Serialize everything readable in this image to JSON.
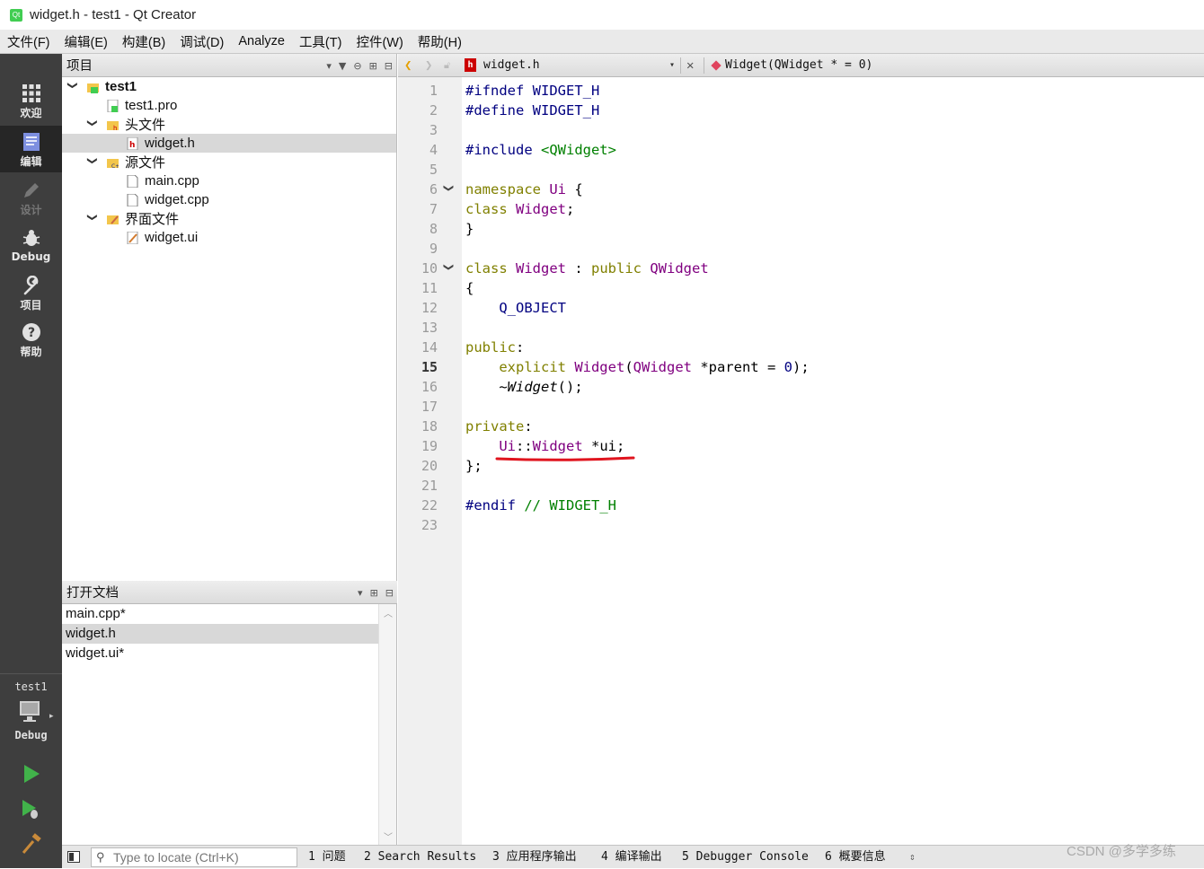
{
  "window": {
    "title": "widget.h - test1 - Qt Creator",
    "app_icon": "Qt"
  },
  "menubar": [
    "文件(F)",
    "编辑(E)",
    "构建(B)",
    "调试(D)",
    "Analyze",
    "工具(T)",
    "控件(W)",
    "帮助(H)"
  ],
  "modes": [
    {
      "label": "欢迎",
      "icon": "grid-icon"
    },
    {
      "label": "编辑",
      "icon": "edit-doc-icon"
    },
    {
      "label": "设计",
      "icon": "pencil-icon"
    },
    {
      "label": "Debug",
      "icon": "bug-icon"
    },
    {
      "label": "项目",
      "icon": "wrench-icon"
    },
    {
      "label": "帮助",
      "icon": "help-icon"
    }
  ],
  "kit": {
    "project": "test1",
    "build": "Debug"
  },
  "project_pane": {
    "title": "项目",
    "tree": [
      {
        "label": "test1"
      },
      {
        "label": "test1.pro"
      },
      {
        "label": "头文件"
      },
      {
        "label": "widget.h"
      },
      {
        "label": "源文件"
      },
      {
        "label": "main.cpp"
      },
      {
        "label": "widget.cpp"
      },
      {
        "label": "界面文件"
      },
      {
        "label": "widget.ui"
      }
    ]
  },
  "open_docs": {
    "title": "打开文档",
    "items": [
      "main.cpp*",
      "widget.h",
      "widget.ui*"
    ]
  },
  "editor": {
    "file": "widget.h",
    "symbol": "Widget(QWidget * = 0)",
    "current_line": 15,
    "line_numbers": [
      "1",
      "2",
      "3",
      "4",
      "5",
      "6",
      "7",
      "8",
      "9",
      "10",
      "11",
      "12",
      "13",
      "14",
      "15",
      "16",
      "17",
      "18",
      "19",
      "20",
      "21",
      "22",
      "23"
    ],
    "lines": {
      "l1a": "#ifndef",
      "l1b": " WIDGET_H",
      "l2a": "#define",
      "l2b": " WIDGET_H",
      "l4a": "#include",
      "l4b": " <QWidget>",
      "l6a": "namespace",
      "l6b": " Ui",
      "l6c": " {",
      "l7a": "class",
      "l7b": " Widget",
      "l7c": ";",
      "l8": "}",
      "l10a": "class",
      "l10b": " Widget",
      "l10c": " : ",
      "l10d": "public",
      "l10e": " QWidget",
      "l11": "{",
      "l12": "    Q_OBJECT",
      "l14a": "public",
      "l14b": ":",
      "l15a": "    explicit",
      "l15b": " Widget",
      "l15c": "(",
      "l15d": "QWidget",
      "l15e": " *parent = ",
      "l15f": "0",
      "l15g": ");",
      "l16a": "    ~",
      "l16b": "Widget",
      "l16c": "();",
      "l18a": "private",
      "l18b": ":",
      "l19a": "    Ui",
      "l19b": "::",
      "l19c": "Widget",
      "l19d": " *ui;",
      "l20": "};",
      "l22a": "#endif",
      "l22b": " // WIDGET_H"
    }
  },
  "statusbar": {
    "locate_placeholder": "Type to locate (Ctrl+K)",
    "tabs": [
      "1  问题",
      "2  Search Results",
      "3  应用程序输出",
      "4  编译输出",
      "5  Debugger Console",
      "6  概要信息"
    ]
  },
  "watermark": "CSDN @多学多练",
  "colors": {
    "keyword": "#808000",
    "type": "#800080",
    "preprocessor": "#000080",
    "include": "#008000",
    "annotation": "#e0141e"
  }
}
